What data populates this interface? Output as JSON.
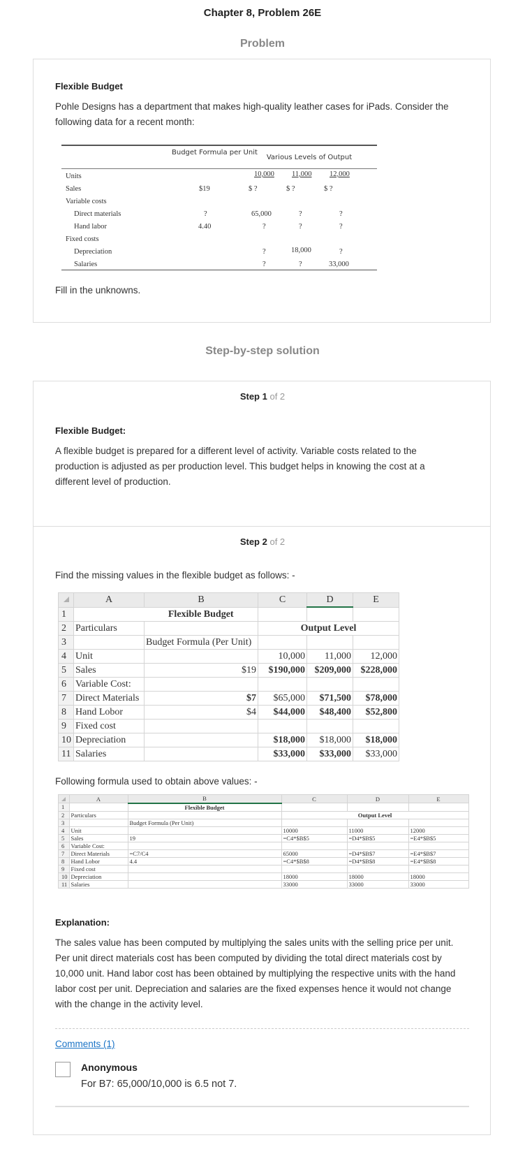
{
  "header": {
    "title": "Chapter 8, Problem 26E"
  },
  "problem": {
    "section_label": "Problem",
    "heading": "Flexible Budget",
    "text": "Pohle Designs has a department that makes high-quality leather cases for iPads. Consider the following data for a recent month:",
    "instruction": "Fill in the unknowns.",
    "table": {
      "header_formula": "Budget Formula per Unit",
      "header_levels": "Various Levels of Output",
      "levels": [
        "10,000",
        "11,000",
        "12,000"
      ],
      "rows": {
        "units": "Units",
        "sales": "Sales",
        "variable_costs": "Variable costs",
        "direct_materials": "Direct materials",
        "hand_labor": "Hand labor",
        "fixed_costs": "Fixed costs",
        "depreciation": "Depreciation",
        "salaries": "Salaries"
      },
      "values": {
        "sales_formula": "$19",
        "sales_levels": [
          "$  ?",
          "$  ?",
          "$  ?"
        ],
        "dm_formula": "?",
        "dm_levels": [
          "65,000",
          "?",
          "?"
        ],
        "hl_formula": "4.40",
        "hl_levels": [
          "?",
          "?",
          "?"
        ],
        "dep_levels": [
          "?",
          "18,000",
          "?"
        ],
        "sal_levels": [
          "?",
          "?",
          "33,000"
        ]
      }
    }
  },
  "solution": {
    "section_label": "Step-by-step solution",
    "step1": {
      "step_word": "Step 1",
      "of": "of 2",
      "heading": "Flexible Budget:",
      "text": "A flexible budget is prepared for a different level of activity. Variable costs related to the production is adjusted as per production level. This budget helps in knowing the cost at a different level of production."
    },
    "step2": {
      "step_word": "Step 2",
      "of": "of 2",
      "intro": "Find the missing values in the flexible budget as follows: -",
      "formula_intro": "Following formula used to obtain above values: -",
      "explanation_heading": "Explanation:",
      "explanation_text": "The sales value has been computed by multiplying the sales units with the selling price per unit. Per unit direct materials cost has been computed by dividing the total direct materials cost by 10,000 unit. Hand labor cost has been obtained by multiplying the respective units with the hand labor cost per unit. Depreciation and salaries are the fixed expenses hence it would not change with the change in the activity level."
    }
  },
  "sheet1": {
    "cols": [
      "A",
      "B",
      "C",
      "D",
      "E"
    ],
    "rownums": [
      "1",
      "2",
      "3",
      "4",
      "5",
      "6",
      "7",
      "8",
      "9",
      "10",
      "11"
    ],
    "title": "Flexible Budget",
    "particulars": "Particulars",
    "output_level": "Output Level",
    "formula_header": "Budget Formula (Per Unit)",
    "labels": [
      "Unit",
      "Sales",
      "Variable Cost:",
      "Direct Materials",
      "Hand Lobor",
      "Fixed cost",
      "Depreciation",
      "Salaries"
    ],
    "unit": [
      "10,000",
      "11,000",
      "12,000"
    ],
    "sales_b": "$19",
    "sales": [
      "$190,000",
      "$209,000",
      "$228,000"
    ],
    "dm_b": "$7",
    "dm": [
      "$65,000",
      "$71,500",
      "$78,000"
    ],
    "hl_b": "$4",
    "hl": [
      "$44,000",
      "$48,400",
      "$52,800"
    ],
    "dep": [
      "$18,000",
      "$18,000",
      "$18,000"
    ],
    "sal": [
      "$33,000",
      "$33,000",
      "$33,000"
    ]
  },
  "sheet2": {
    "cols": [
      "A",
      "B",
      "C",
      "D",
      "E"
    ],
    "rownums": [
      "1",
      "2",
      "3",
      "4",
      "5",
      "6",
      "7",
      "8",
      "9",
      "10",
      "11"
    ],
    "title": "Flexible Budget",
    "particulars": "Particulars",
    "output_level": "Output Level",
    "formula_header": "Budget Formula (Per Unit)",
    "labels": [
      "Unit",
      "Sales",
      "Variable Cost:",
      "Direct Materials",
      "Hand Lobor",
      "Fixed cost",
      "Depreciation",
      "Salaries"
    ],
    "unit": [
      "10000",
      "11000",
      "12000"
    ],
    "sales_b": "19",
    "sales": [
      "=C4*$B$5",
      "=D4*$B$5",
      "=E4*$B$5"
    ],
    "dm_b": "=C7/C4",
    "dm": [
      "65000",
      "=D4*$B$7",
      "=E4*$B$7"
    ],
    "hl_b": "4.4",
    "hl": [
      "=C4*$B$8",
      "=D4*$B$8",
      "=E4*$B$8"
    ],
    "dep": [
      "18000",
      "18000",
      "18000"
    ],
    "sal": [
      "33000",
      "33000",
      "33000"
    ]
  },
  "comments": {
    "link": "Comments (1)",
    "author": "Anonymous",
    "text": "For B7: 65,000/10,000 is 6.5 not 7."
  }
}
